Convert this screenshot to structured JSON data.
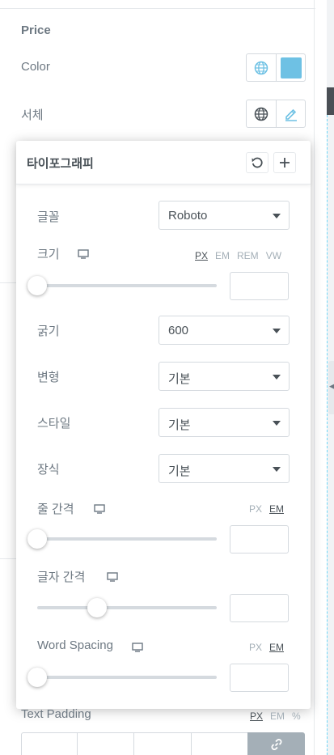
{
  "section": {
    "title": "Price"
  },
  "color_control": {
    "label": "Color",
    "swatch_color": "#6ec1e4",
    "globe_icon": "globe-icon"
  },
  "font_control": {
    "label": "서체",
    "globe_icon": "globe-icon",
    "edit_icon": "pencil-icon"
  },
  "typography": {
    "title": "타이포그래피",
    "reset_icon": "reset-icon",
    "add_icon": "plus-icon",
    "family": {
      "label": "글꼴",
      "value": "Roboto"
    },
    "size": {
      "label": "크기",
      "units": [
        "PX",
        "EM",
        "REM",
        "VW"
      ],
      "active_unit": "PX",
      "value": "",
      "slider_fraction": 0.0
    },
    "weight": {
      "label": "굵기",
      "value": "600"
    },
    "transform": {
      "label": "변형",
      "value": "기본"
    },
    "style": {
      "label": "스타일",
      "value": "기본"
    },
    "decoration": {
      "label": "장식",
      "value": "기본"
    },
    "line_height": {
      "label": "줄 간격",
      "units": [
        "PX",
        "EM"
      ],
      "active_unit": "EM",
      "value": "",
      "slider_fraction": 0.0
    },
    "letter_spacing": {
      "label": "글자 간격",
      "value": "",
      "slider_fraction": 0.33
    },
    "word_spacing": {
      "label": "Word Spacing",
      "units": [
        "PX",
        "EM"
      ],
      "active_unit": "EM",
      "value": "",
      "slider_fraction": 0.0
    }
  },
  "text_padding": {
    "label": "Text Padding",
    "units": [
      "PX",
      "EM",
      "%"
    ],
    "active_unit": "PX",
    "link_icon": "link-icon"
  },
  "colors": {
    "accent": "#6ec1e4",
    "text": "#6d7882",
    "border": "#d5dadf",
    "link_bg": "#a4afb7"
  }
}
